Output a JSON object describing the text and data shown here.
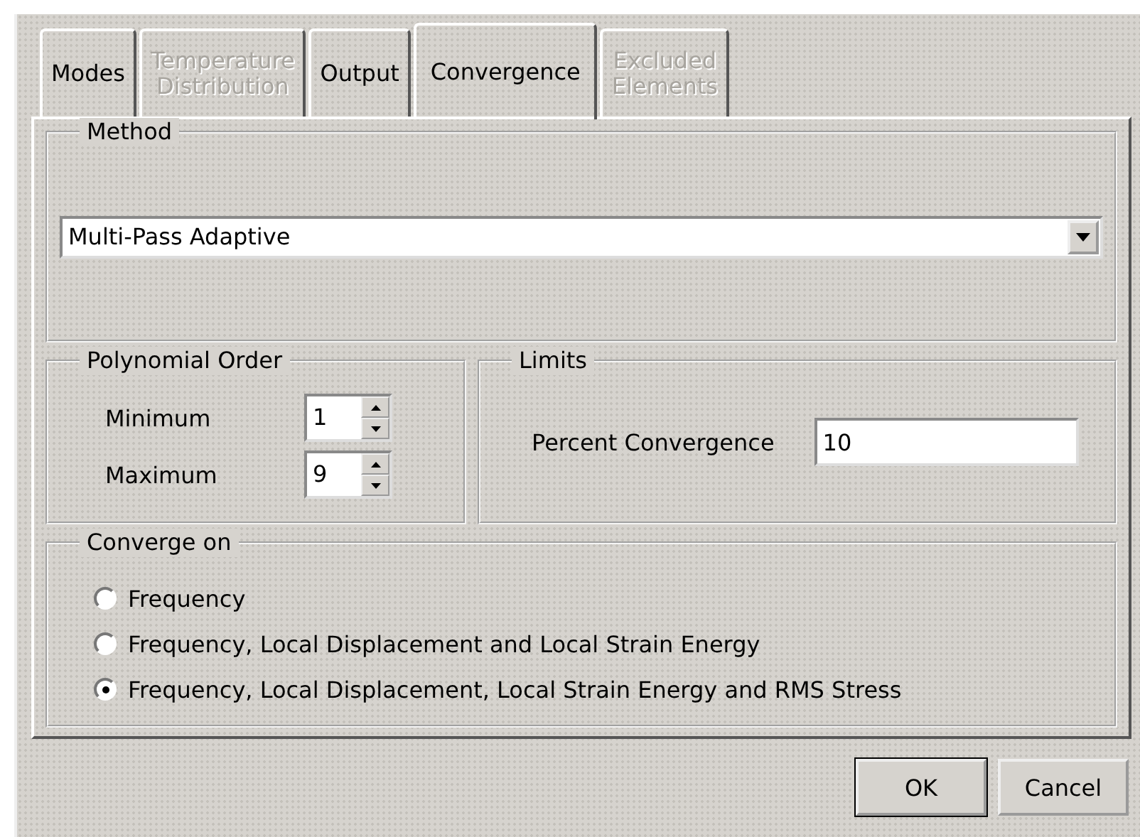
{
  "tabs": [
    {
      "label": "Modes",
      "selected": false,
      "disabled": false
    },
    {
      "label": "Temperature\nDistribution",
      "selected": false,
      "disabled": true
    },
    {
      "label": "Output",
      "selected": false,
      "disabled": false
    },
    {
      "label": "Convergence",
      "selected": true,
      "disabled": false
    },
    {
      "label": "Excluded\nElements",
      "selected": false,
      "disabled": true
    }
  ],
  "method": {
    "legend": "Method",
    "value": "Multi-Pass Adaptive"
  },
  "polynomial_order": {
    "legend": "Polynomial Order",
    "fields": [
      {
        "label": "Minimum",
        "value": "1"
      },
      {
        "label": "Maximum",
        "value": "9"
      }
    ]
  },
  "limits": {
    "legend": "Limits",
    "label": "Percent Convergence",
    "value": "10"
  },
  "converge_on": {
    "legend": "Converge on",
    "options": [
      {
        "label": "Frequency",
        "selected": false
      },
      {
        "label": "Frequency, Local Displacement and Local Strain Energy",
        "selected": false
      },
      {
        "label": "Frequency, Local Displacement, Local Strain Energy and RMS Stress",
        "selected": true
      }
    ]
  },
  "buttons": [
    "OK",
    "Cancel"
  ]
}
